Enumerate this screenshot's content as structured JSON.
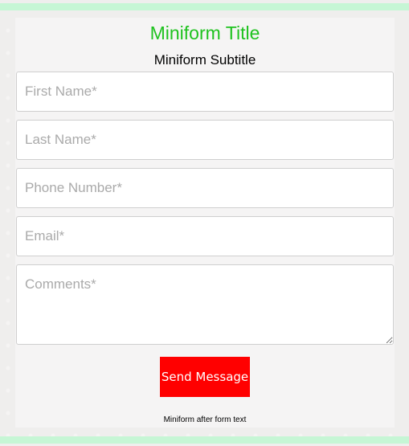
{
  "form": {
    "title": "Miniform Title",
    "subtitle": "Miniform Subtitle",
    "fields": {
      "first_name": {
        "value": "",
        "placeholder": "First Name*"
      },
      "last_name": {
        "value": "",
        "placeholder": "Last Name*"
      },
      "phone": {
        "value": "",
        "placeholder": "Phone Number*"
      },
      "email": {
        "value": "",
        "placeholder": "Email*"
      },
      "comments": {
        "value": "",
        "placeholder": "Comments*"
      }
    },
    "submit_label": "Send Message",
    "after_text": "Miniform after form text"
  },
  "colors": {
    "title": "#1fc21f",
    "button": "#ff0000",
    "frame_bar": "#c6f6d5"
  }
}
